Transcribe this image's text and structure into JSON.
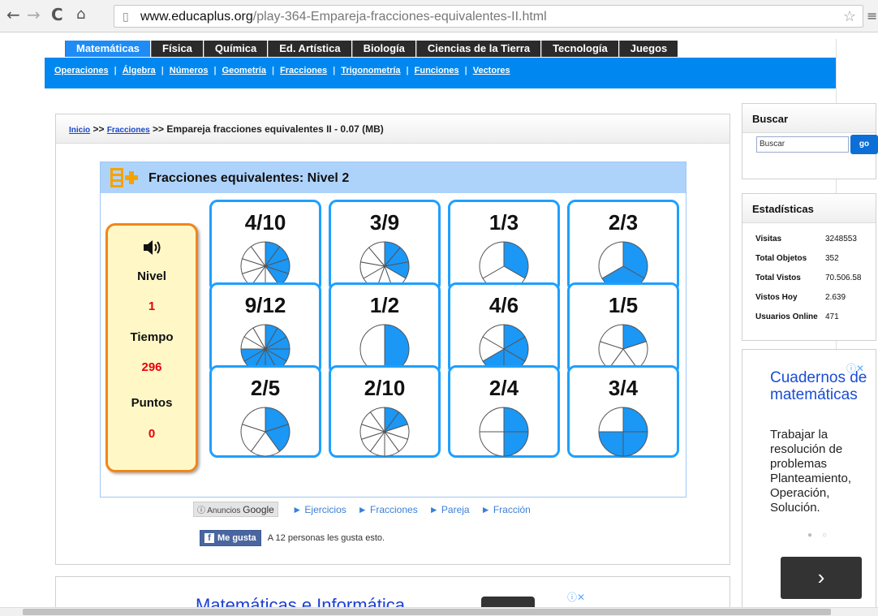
{
  "browser": {
    "url_host": "www.educaplus.org",
    "url_path": "/play-364-Empareja-fracciones-equivalentes-II.html",
    "back_icon": "back-arrow-icon",
    "forward_icon": "forward-arrow-icon",
    "reload_icon": "reload-icon",
    "home_icon": "home-icon"
  },
  "tabs": [
    "Matemáticas",
    "Física",
    "Química",
    "Ed. Artística",
    "Biología",
    "Ciencias de la Tierra",
    "Tecnología",
    "Juegos"
  ],
  "subnav": [
    "Operaciones",
    "Álgebra",
    "Números",
    "Geometría",
    "Fracciones",
    "Trigonometría",
    "Funciones",
    "Vectores"
  ],
  "breadcrumb": {
    "home": "Inicio",
    "sep": ">>",
    "section": "Fracciones",
    "current": "Empareja fracciones equivalentes II - 0.07 (MB)"
  },
  "game": {
    "title": "Fracciones equivalentes: Nivel 2",
    "labels": {
      "level": "Nivel",
      "time": "Tiempo",
      "points": "Puntos"
    },
    "values": {
      "level": "1",
      "time": "296",
      "points": "0"
    },
    "cards": [
      {
        "label": "4/10",
        "num": 4,
        "den": 10
      },
      {
        "label": "3/9",
        "num": 3,
        "den": 9
      },
      {
        "label": "1/3",
        "num": 1,
        "den": 3
      },
      {
        "label": "2/3",
        "num": 2,
        "den": 3
      },
      {
        "label": "9/12",
        "num": 9,
        "den": 12
      },
      {
        "label": "1/2",
        "num": 1,
        "den": 2
      },
      {
        "label": "4/6",
        "num": 4,
        "den": 6
      },
      {
        "label": "1/5",
        "num": 1,
        "den": 5
      },
      {
        "label": "2/5",
        "num": 2,
        "den": 5
      },
      {
        "label": "2/10",
        "num": 2,
        "den": 10
      },
      {
        "label": "2/4",
        "num": 2,
        "den": 4
      },
      {
        "label": "3/4",
        "num": 3,
        "den": 4
      }
    ],
    "fill_color": "#1b97f5"
  },
  "ads_bar": {
    "badge_prefix": "Anuncios",
    "badge_brand": "Google",
    "links": [
      "Ejercicios",
      "Fracciones",
      "Pareja",
      "Fracción"
    ]
  },
  "like": {
    "button": "Me gusta",
    "text": "A 12 personas les gusta esto."
  },
  "box2_title": "Matemáticas e Informática",
  "search": {
    "title": "Buscar",
    "input": "Buscar",
    "button": "go"
  },
  "stats": {
    "title": "Estadísticas",
    "rows": [
      {
        "k": "Visitas",
        "v": "3248553"
      },
      {
        "k": "Total Objetos",
        "v": "352"
      },
      {
        "k": "Total Vistos",
        "v": "70.506.58"
      },
      {
        "k": "Vistos Hoy",
        "v": "2.639"
      },
      {
        "k": "Usuarios Online",
        "v": "471"
      }
    ]
  },
  "ad2": {
    "title": "Cuadernos de matemáticas",
    "body": "Trabajar la resolución de problemas Planteamiento, Operación, Solución.",
    "next": "›"
  }
}
